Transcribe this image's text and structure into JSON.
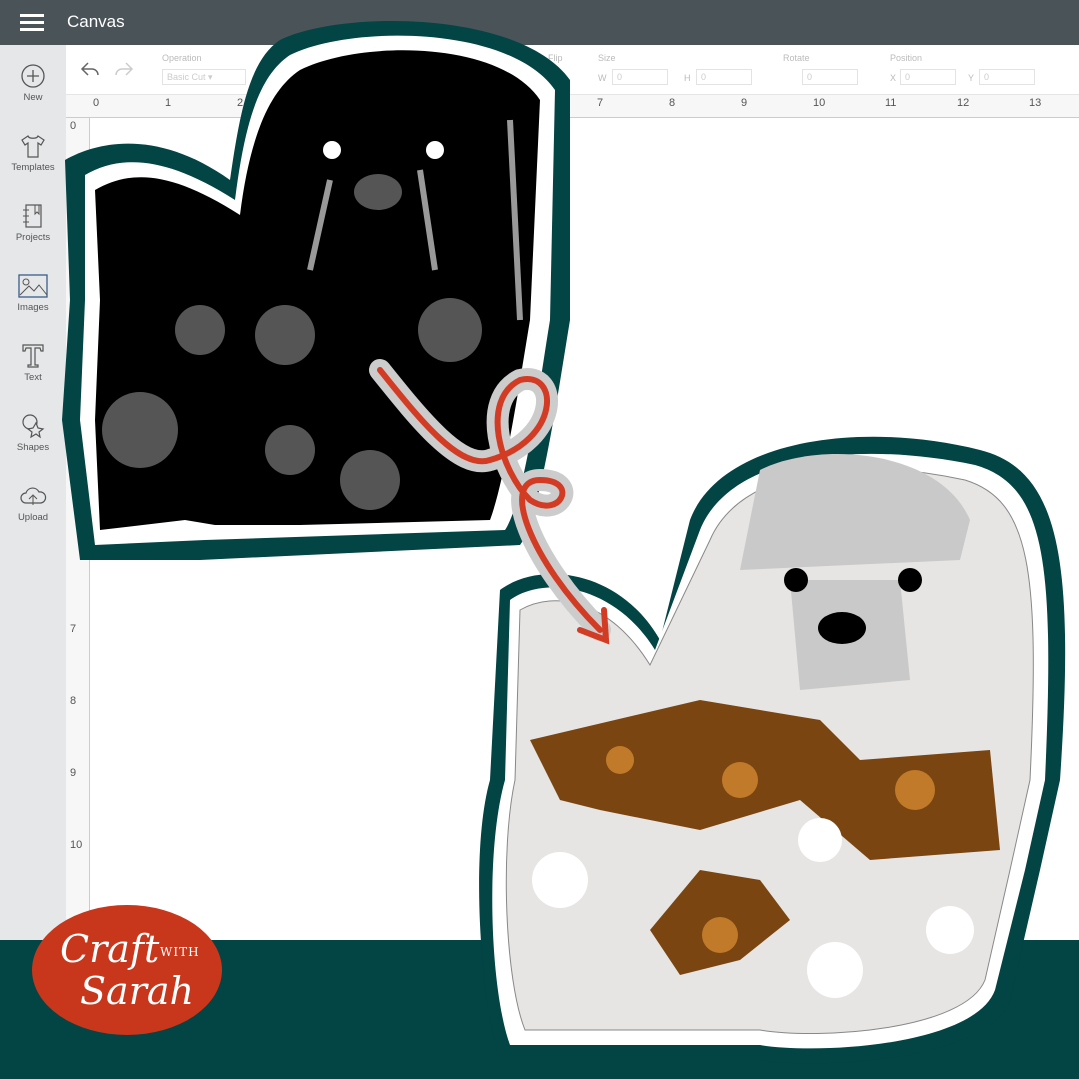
{
  "header": {
    "title": "Canvas",
    "menu_icon": "hamburger-icon"
  },
  "sidebar": {
    "items": [
      {
        "label": "New",
        "icon": "plus-circle-icon"
      },
      {
        "label": "Templates",
        "icon": "shirt-icon"
      },
      {
        "label": "Projects",
        "icon": "notebook-icon"
      },
      {
        "label": "Images",
        "icon": "image-icon"
      },
      {
        "label": "Text",
        "icon": "text-icon"
      },
      {
        "label": "Shapes",
        "icon": "shapes-icon"
      },
      {
        "label": "Upload",
        "icon": "upload-cloud-icon"
      }
    ]
  },
  "toolbar": {
    "operation_label": "Operation",
    "operation_value": "Basic Cut",
    "flip_label": "Flip",
    "size_label": "Size",
    "w_label": "W",
    "h_label": "H",
    "w_value": "0",
    "h_value": "0",
    "rotate_label": "Rotate",
    "rotate_value": "0",
    "position_label": "Position",
    "x_label": "X",
    "y_label": "Y",
    "x_value": "0",
    "y_value": "0"
  },
  "ruler": {
    "h": [
      "0",
      "1",
      "2",
      "7",
      "8",
      "9",
      "10",
      "11",
      "12",
      "13"
    ],
    "v": [
      "0",
      "7",
      "8",
      "9",
      "10"
    ]
  },
  "logo": {
    "line1": "Craft",
    "line2": "WITH",
    "line3": "Sarah"
  },
  "colors": {
    "teal": "#034445",
    "logo_red": "#c8361c",
    "arrow": "#d23c24",
    "brown": "#7a4510"
  }
}
